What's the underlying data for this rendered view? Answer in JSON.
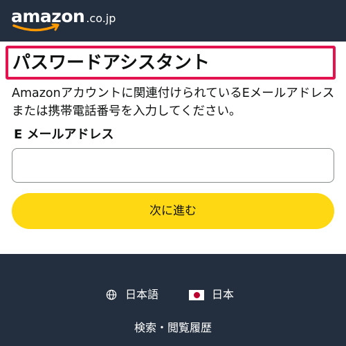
{
  "header": {
    "logo_word": "amazon",
    "logo_domain": ".co.jp"
  },
  "main": {
    "title": "パスワードアシスタント",
    "description": "Amazonアカウントに関連付けられているEメールアドレスまたは携帯電話番号を入力してください。",
    "email_label": "E メールアドレス",
    "email_value": "",
    "email_placeholder": "",
    "continue_label": "次に進む"
  },
  "footer": {
    "language_label": "日本語",
    "country_label": "日本",
    "history_link": "検索・閲覧履歴"
  },
  "colors": {
    "header_bg": "#232f3e",
    "button_bg": "#ffd814",
    "highlight_border": "#e3134f",
    "logo_smile": "#ff9900"
  },
  "icons": {
    "language": "globe-icon",
    "country": "japan-flag-icon"
  }
}
